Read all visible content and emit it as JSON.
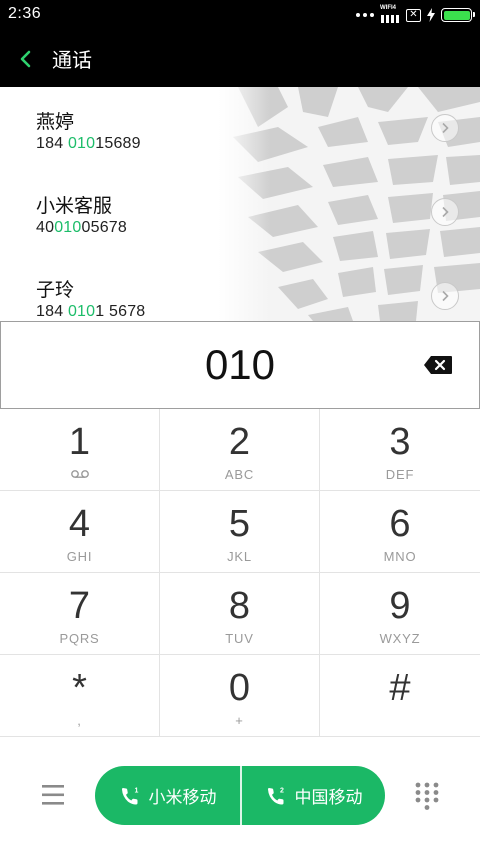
{
  "status_bar": {
    "time": "2:36",
    "network_label": "WIFI4",
    "sim_x": "✕",
    "battery_color": "#3be04d"
  },
  "header": {
    "title": "通话",
    "back_icon": "back-chevron-icon"
  },
  "contacts": [
    {
      "name": "燕婷",
      "number_pre": "184 ",
      "number_match": "010",
      "number_post": "15689"
    },
    {
      "name": "小米客服",
      "number_pre": "40",
      "number_match": "010",
      "number_post": "05678"
    },
    {
      "name": "子玲",
      "number_pre": "184 ",
      "number_match": "010",
      "number_post": "1 5678"
    }
  ],
  "dialed_number": "010",
  "keypad": [
    {
      "digit": "1",
      "sub": "",
      "sub_icon": "voicemail-icon"
    },
    {
      "digit": "2",
      "sub": "ABC"
    },
    {
      "digit": "3",
      "sub": "DEF"
    },
    {
      "digit": "4",
      "sub": "GHI"
    },
    {
      "digit": "5",
      "sub": "JKL"
    },
    {
      "digit": "6",
      "sub": "MNO"
    },
    {
      "digit": "7",
      "sub": "PQRS"
    },
    {
      "digit": "8",
      "sub": "TUV"
    },
    {
      "digit": "9",
      "sub": "WXYZ"
    },
    {
      "digit": "*",
      "sub": ","
    },
    {
      "digit": "0",
      "sub": "+"
    },
    {
      "digit": "#",
      "sub": ""
    }
  ],
  "bottom_bar": {
    "call_sim1_label": "小米移动",
    "call_sim2_label": "中国移动",
    "accent_color": "#1bb866"
  },
  "colors": {
    "highlight": "#1dbd6a",
    "header_bg": "#000000"
  }
}
